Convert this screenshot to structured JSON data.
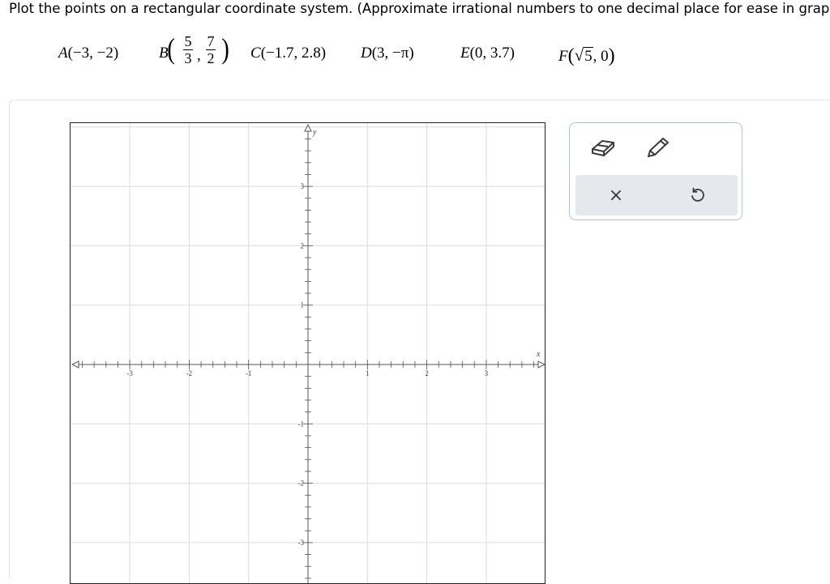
{
  "instruction": "Plot the points on a rectangular coordinate system. (Approximate irrational numbers to one decimal place for ease in graph",
  "points": {
    "A": {
      "letter": "A",
      "coords": "(−3, −2)"
    },
    "B": {
      "letter": "B",
      "x_num": "5",
      "x_den": "3",
      "sep": ",",
      "y_num": "7",
      "y_den": "2"
    },
    "C": {
      "letter": "C",
      "coords": "(−1.7, 2.8)"
    },
    "D": {
      "letter": "D",
      "coords": "(3, −π)"
    },
    "E": {
      "letter": "E",
      "coords": "(0, 3.7)"
    },
    "F": {
      "letter": "F",
      "radicand": "5",
      "rest": ", 0"
    }
  },
  "graph": {
    "x_axis_label": "x",
    "y_axis_label": "y",
    "x_tick_labels": [
      "-3",
      "-2",
      "-1",
      "1",
      "2",
      "3"
    ],
    "y_tick_labels": [
      "3",
      "2",
      "1",
      "-1",
      "-2",
      "-3"
    ]
  },
  "tools": {
    "eraser": "eraser-icon",
    "pencil": "pencil-icon",
    "clear": "×",
    "undo": "undo-icon"
  },
  "colors": {
    "grid": "#dcdcdc",
    "axis": "#555555",
    "tool_border": "#a7c5dd",
    "action_bar": "#e5e9ee",
    "icon": "#3b3b3b"
  }
}
